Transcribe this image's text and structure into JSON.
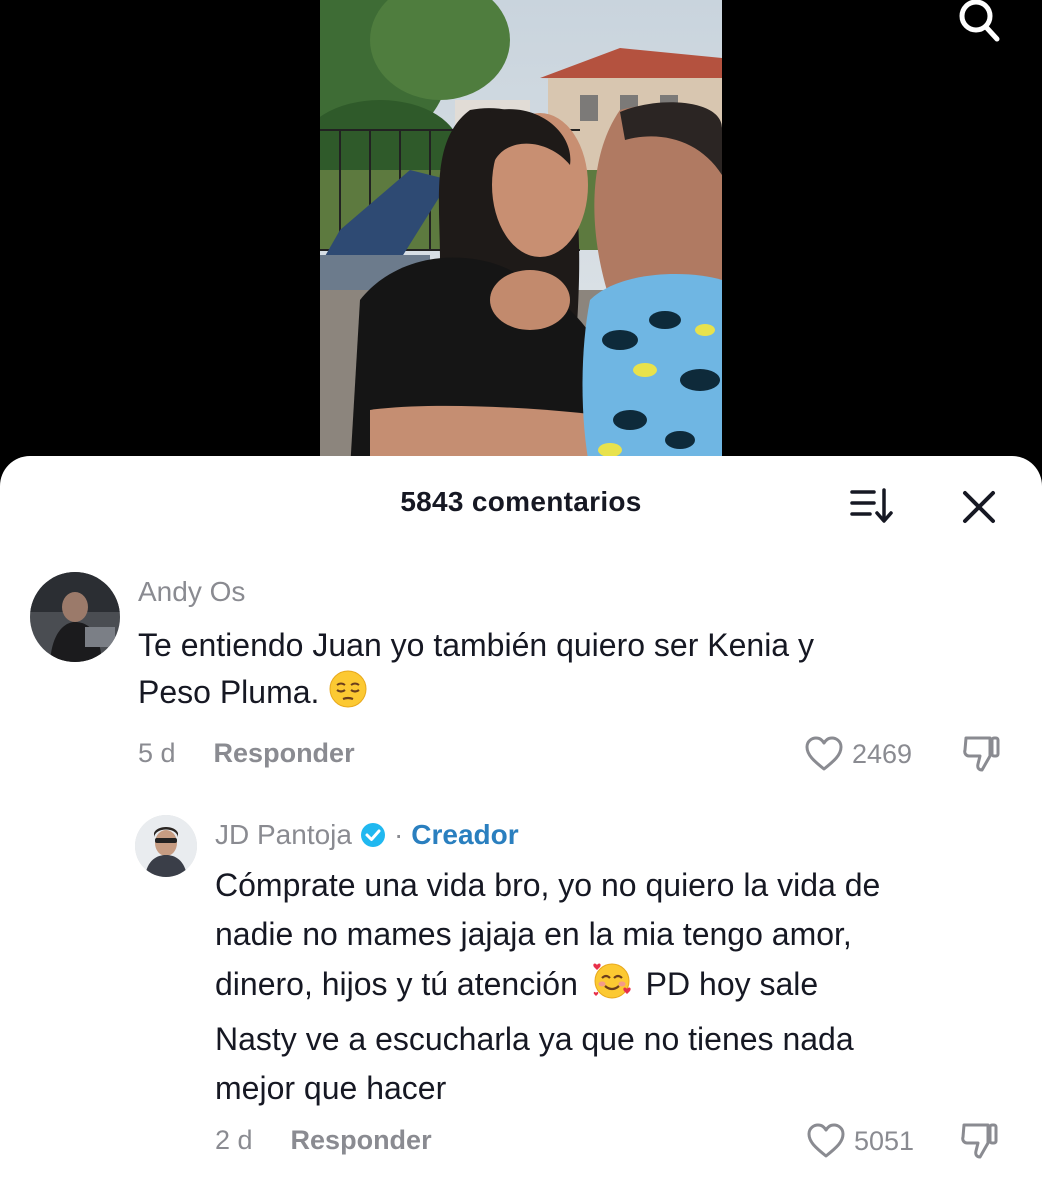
{
  "header": {
    "comment_count": "5843 comentarios"
  },
  "comments": [
    {
      "username": "Andy Os",
      "text_line1": "Te entiendo Juan yo también quiero ser Kenia y",
      "text_line2": "Peso Pluma.",
      "emoji": "pensive-face",
      "age": "5 d",
      "reply_label": "Responder",
      "likes": "2469"
    },
    {
      "username": "JD Pantoja",
      "verified": true,
      "separator": "·",
      "badge": "Creador",
      "text_line1": "Cómprate una vida bro, yo no quiero la vida de",
      "text_line2": "nadie no mames jajaja en la mia tengo amor,",
      "text_line3a": "dinero, hijos y tú atención",
      "text_line3b": "PD hoy sale",
      "text_line4": "Nasty ve a escucharla ya que no tienes nada",
      "text_line5": "mejor que hacer",
      "emoji": "smiling-face-with-hearts",
      "age": "2 d",
      "reply_label": "Responder",
      "likes": "5051"
    }
  ],
  "icons": {
    "search": "search-icon",
    "sort": "sort-icon",
    "close": "close-icon",
    "like": "heart-outline-icon",
    "dislike": "thumbs-down-icon",
    "verified": "verified-check-icon"
  },
  "colors": {
    "creator_badge": "#2a7fbf",
    "verified": "#20b8f0",
    "muted_text": "#8a8b91",
    "main_text": "#161823"
  }
}
